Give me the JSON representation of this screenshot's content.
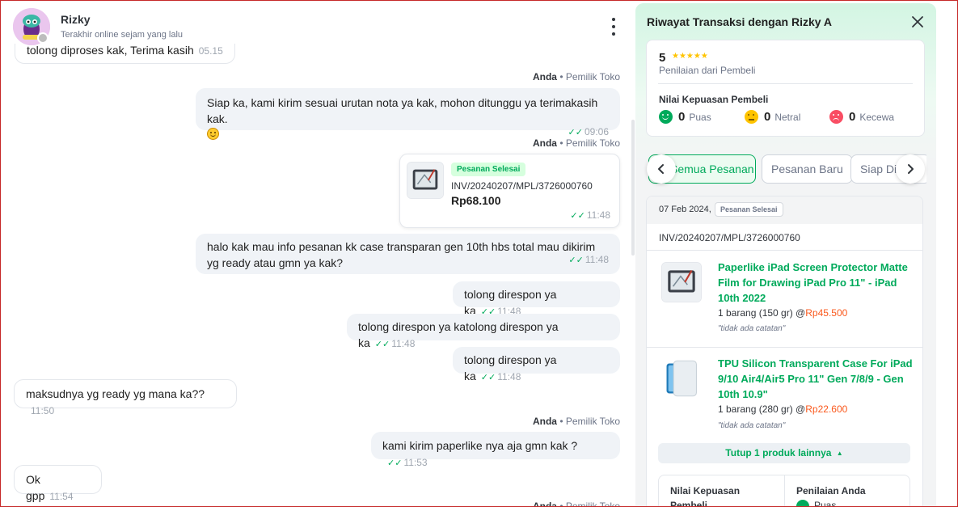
{
  "chat": {
    "contact": {
      "name": "Rizky",
      "status": "Terakhir online sejam yang lalu"
    },
    "partial_top": {
      "text": "tolong diproses kak, Terima kasih",
      "time": "05.15"
    },
    "sender_label": {
      "name": "Anda",
      "role": "Pemilik Toko"
    },
    "messages": [
      {
        "text": "Siap ka, kami kirim sesuai urutan nota ya kak, mohon ditunggu ya terimakasih kak.",
        "time": "09:06"
      },
      {
        "text": "halo kak mau info pesanan kk case transparan gen 10th hbs total mau dikirim yg ready atau gmn ya kak?",
        "time": "11:48"
      },
      {
        "text": "tolong direspon ya ka",
        "time": "11:48"
      },
      {
        "text": "tolong direspon ya katolong direspon ya ka",
        "time": "11:48"
      },
      {
        "text": "tolong direspon ya ka",
        "time": "11:48"
      },
      {
        "text": "maksudnya yg ready yg mana ka??",
        "time": "11:50"
      },
      {
        "text": "kami kirim paperlike nya aja gmn kak ?",
        "time": "11:53"
      },
      {
        "text": "Ok gpp",
        "time": "11:54"
      }
    ],
    "order_card": {
      "badge": "Pesanan Selesai",
      "invoice": "INV/20240207/MPL/3726000760",
      "price": "Rp68.100",
      "time": "11:48"
    }
  },
  "panel": {
    "title": "Riwayat Transaksi dengan Rizky A",
    "rating": {
      "score": "5",
      "label": "Penilaian dari Pembeli",
      "satisfaction_title": "Nilai Kepuasan Pembeli",
      "puas": {
        "count": "0",
        "label": "Puas"
      },
      "netral": {
        "count": "0",
        "label": "Netral"
      },
      "kecewa": {
        "count": "0",
        "label": "Kecewa"
      }
    },
    "filters": [
      "Semua Pesanan",
      "Pesanan Baru",
      "Siap Dikirim"
    ],
    "order": {
      "date": "07 Feb 2024,",
      "status": "Pesanan Selesai",
      "invoice": "INV/20240207/MPL/3726000760",
      "products": [
        {
          "name": "Paperlike iPad Screen Protector Matte Film for Drawing iPad Pro 11\" - iPad 10th 2022",
          "qty": "1 barang (150 gr) @",
          "price": "Rp45.500",
          "note": "\"tidak ada catatan\""
        },
        {
          "name": "TPU Silicon Transparent Case For iPad 9/10 Air4/Air5 Pro 11\" Gen 7/8/9 - Gen 10th 10.9\"",
          "qty": "1 barang (280 gr) @",
          "price": "Rp22.600",
          "note": "\"tidak ada catatan\""
        }
      ],
      "collapse_label": "Tutup 1 produk lainnya",
      "footer": {
        "left_title": "Nilai Kepuasan Pembeli",
        "right_title": "Penilaian Anda",
        "right_value": "Puas"
      }
    }
  },
  "colors": {
    "accent": "#00aa5b",
    "price": "#fa591d",
    "bubble_out": "#f0f3f7"
  },
  "icons": [
    "kebab-menu-icon",
    "close-icon",
    "chevron-left-icon",
    "chevron-right-icon",
    "double-check-icon",
    "smile-emoji-icon",
    "chevron-up-icon"
  ]
}
